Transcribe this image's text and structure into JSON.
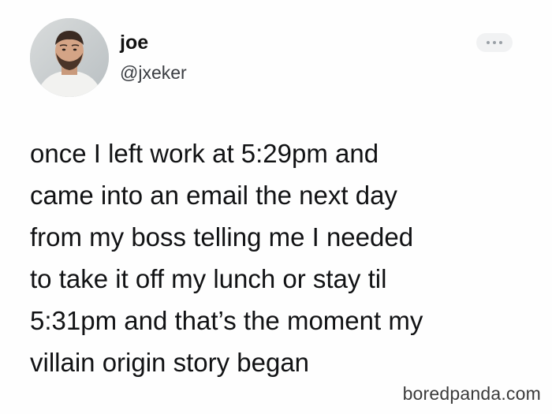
{
  "tweet": {
    "author": {
      "name": "joe",
      "handle": "@jxeker"
    },
    "text_lines": [
      "once I left work at 5:29pm and",
      "came into an email the next day",
      "from my boss telling me I needed",
      "to take it off my lunch or stay til",
      "5:31pm and that’s the moment my",
      "villain origin story began"
    ],
    "more_icon": "more-horizontal-icon"
  },
  "watermark": {
    "text": "boredpanda.com"
  },
  "colors": {
    "background": "#ffffff",
    "text": "#111214",
    "handle": "#3a3d42"
  }
}
